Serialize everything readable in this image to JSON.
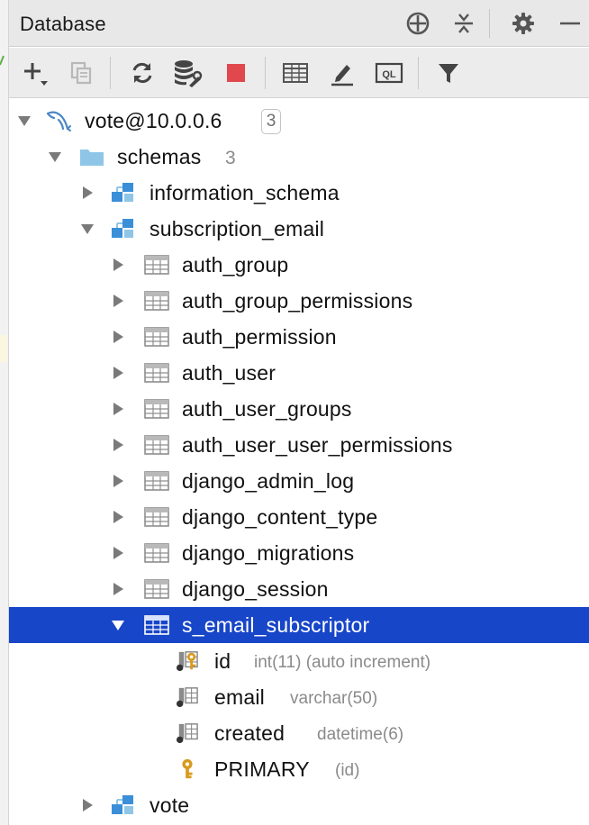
{
  "window": {
    "title": "Database"
  },
  "header_buttons": [
    {
      "name": "add-datasource-crosshair",
      "icon": "crosshair-icon"
    },
    {
      "name": "collapse-all",
      "icon": "collapse-icon"
    },
    {
      "name": "settings",
      "icon": "gear-icon"
    },
    {
      "name": "hide-panel",
      "icon": "minimize-icon"
    }
  ],
  "toolbar": {
    "buttons": [
      "add-icon",
      "duplicate-icon",
      "refresh-icon",
      "database-properties-icon",
      "stop-icon",
      "table-view-icon",
      "edit-icon",
      "sql-console-icon",
      "filter-icon"
    ],
    "sql_console_text": "QL"
  },
  "colors": {
    "selection": "#1846c9",
    "folder": "#8fc6e8",
    "schema_blue": "#3b8fd8",
    "stop_red": "#e0484e",
    "key_gold": "#d99a1e",
    "meta_grey": "#8a8a8a"
  },
  "tree": {
    "datasource": {
      "label": "vote@10.0.0.6",
      "badge": "3"
    },
    "schemas_folder": {
      "label": "schemas",
      "count": "3"
    },
    "schemas": [
      {
        "label": "information_schema"
      },
      {
        "label": "subscription_email"
      }
    ],
    "tables": [
      {
        "label": "auth_group"
      },
      {
        "label": "auth_group_permissions"
      },
      {
        "label": "auth_permission"
      },
      {
        "label": "auth_user"
      },
      {
        "label": "auth_user_groups"
      },
      {
        "label": "auth_user_user_permissions"
      },
      {
        "label": "django_admin_log"
      },
      {
        "label": "django_content_type"
      },
      {
        "label": "django_migrations"
      },
      {
        "label": "django_session"
      }
    ],
    "selected_table": {
      "label": "s_email_subscriptor"
    },
    "columns": [
      {
        "label": "id",
        "meta": "int(11) (auto increment)",
        "icon": "primary-key-column-icon"
      },
      {
        "label": "email",
        "meta": "varchar(50)",
        "icon": "column-icon"
      },
      {
        "label": "created",
        "meta": "datetime(6)",
        "icon": "column-icon"
      }
    ],
    "key": {
      "label": "PRIMARY",
      "meta": "(id)"
    },
    "last_schema": {
      "label": "vote"
    }
  }
}
